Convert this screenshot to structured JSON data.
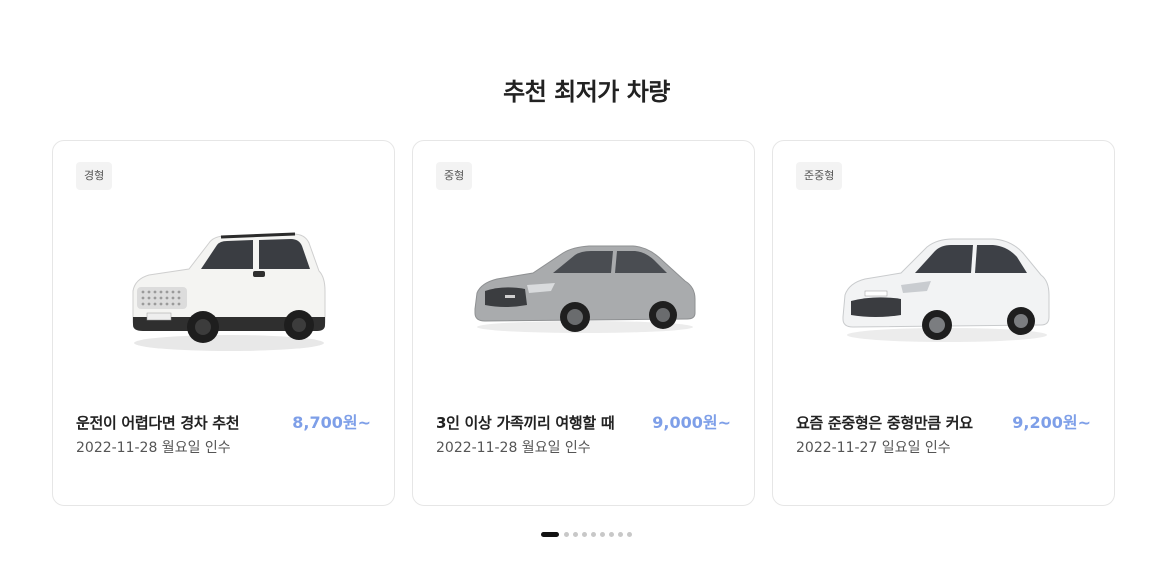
{
  "section": {
    "title": "추천 최저가 차량"
  },
  "cards": [
    {
      "badge": "경형",
      "title": "운전이 어렵다면 경차 추천",
      "price": "8,700원~",
      "date": "2022-11-28 월요일 인수",
      "car_color": "#f4f4f2"
    },
    {
      "badge": "중형",
      "title": "3인 이상 가족끼리 여행할 때",
      "price": "9,000원~",
      "date": "2022-11-28 월요일 인수",
      "car_color": "#a9abad"
    },
    {
      "badge": "준중형",
      "title": "요즘 준중형은 중형만큼 커요",
      "price": "9,200원~",
      "date": "2022-11-27 일요일 인수",
      "car_color": "#f2f3f4"
    }
  ],
  "pagination": {
    "total_pages": 9,
    "active_index": 0
  },
  "colors": {
    "price_accent": "#7e9fe8",
    "active_dot": "#111111",
    "inactive_dot": "#c8c8c8"
  }
}
